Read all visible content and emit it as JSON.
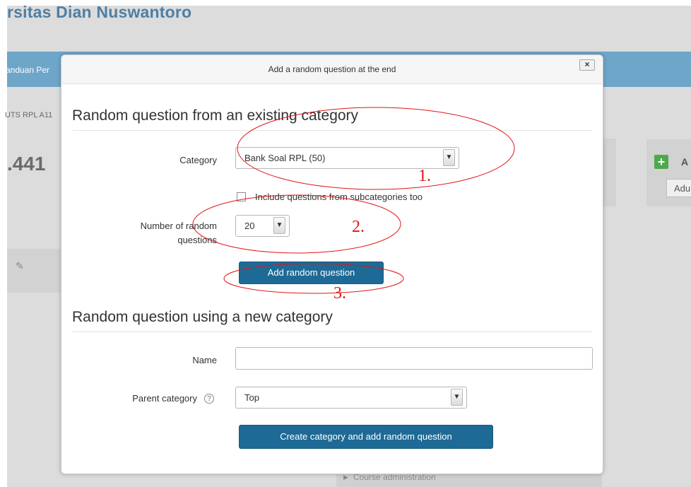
{
  "background": {
    "site_title": "rsitas Dian Nuswantoro",
    "nav_link": "anduan Per",
    "breadcrumb": "UTS RPL A11",
    "grade_text": ".441",
    "side_block_title": "A",
    "side_block_button": "Adu",
    "course_admin": "Course administration",
    "icons": {
      "pencil": "pencil-icon",
      "plus": "plus-icon",
      "arrow": "caret-right-icon"
    }
  },
  "dialog": {
    "title": "Add a random question at the end",
    "close_label": "×",
    "existing_section": {
      "title": "Random question from an existing category",
      "category_label": "Category",
      "category_value": "Bank Soal RPL (50)",
      "subcategories_label": "Include questions from subcategories too",
      "subcategories_checked": false,
      "number_label_line1": "Number of random",
      "number_label_line2": "questions",
      "number_value": "20",
      "add_button": "Add random question"
    },
    "new_section": {
      "title": "Random question using a new category",
      "name_label": "Name",
      "name_value": "",
      "parent_label": "Parent category",
      "parent_value": "Top",
      "create_button": "Create category and add random question"
    }
  },
  "annotations": {
    "color": "#e21414",
    "labels": [
      "1.",
      "2.",
      "3."
    ]
  },
  "colors": {
    "primary_button": "#1e6a96",
    "navbar": "#6da6c9",
    "overlay_bg": "#dcdcdc"
  }
}
